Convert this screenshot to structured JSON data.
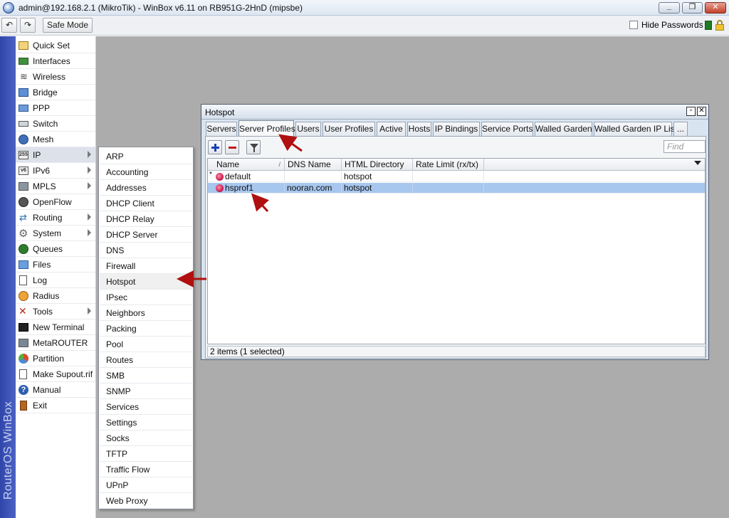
{
  "window": {
    "title": "admin@192.168.2.1 (MikroTik) - WinBox v6.11 on RB951G-2HnD (mipsbe)"
  },
  "toolbar": {
    "safe_mode_label": "Safe Mode",
    "hide_passwords_label": "Hide Passwords"
  },
  "sidebar": {
    "brand": "RouterOS WinBox",
    "items": [
      {
        "label": "Quick Set",
        "icon": "quick-set-icon"
      },
      {
        "label": "Interfaces",
        "icon": "interfaces-icon"
      },
      {
        "label": "Wireless",
        "icon": "wireless-icon"
      },
      {
        "label": "Bridge",
        "icon": "bridge-icon"
      },
      {
        "label": "PPP",
        "icon": "ppp-icon"
      },
      {
        "label": "Switch",
        "icon": "switch-icon"
      },
      {
        "label": "Mesh",
        "icon": "mesh-icon"
      },
      {
        "label": "IP",
        "icon": "ip-icon"
      },
      {
        "label": "IPv6",
        "icon": "ipv6-icon"
      },
      {
        "label": "MPLS",
        "icon": "mpls-icon"
      },
      {
        "label": "OpenFlow",
        "icon": "openflow-icon"
      },
      {
        "label": "Routing",
        "icon": "routing-icon"
      },
      {
        "label": "System",
        "icon": "system-icon"
      },
      {
        "label": "Queues",
        "icon": "queues-icon"
      },
      {
        "label": "Files",
        "icon": "files-icon"
      },
      {
        "label": "Log",
        "icon": "log-icon"
      },
      {
        "label": "Radius",
        "icon": "radius-icon"
      },
      {
        "label": "Tools",
        "icon": "tools-icon"
      },
      {
        "label": "New Terminal",
        "icon": "terminal-icon"
      },
      {
        "label": "MetaROUTER",
        "icon": "metarouter-icon"
      },
      {
        "label": "Partition",
        "icon": "partition-icon"
      },
      {
        "label": "Make Supout.rif",
        "icon": "supout-icon"
      },
      {
        "label": "Manual",
        "icon": "manual-icon"
      },
      {
        "label": "Exit",
        "icon": "exit-icon"
      }
    ]
  },
  "ip_submenu": {
    "items": [
      "ARP",
      "Accounting",
      "Addresses",
      "DHCP Client",
      "DHCP Relay",
      "DHCP Server",
      "DNS",
      "Firewall",
      "Hotspot",
      "IPsec",
      "Neighbors",
      "Packing",
      "Pool",
      "Routes",
      "SMB",
      "SNMP",
      "Services",
      "Settings",
      "Socks",
      "TFTP",
      "Traffic Flow",
      "UPnP",
      "Web Proxy"
    ]
  },
  "hotspot": {
    "title": "Hotspot",
    "tabs": [
      "Servers",
      "Server Profiles",
      "Users",
      "User Profiles",
      "Active",
      "Hosts",
      "IP Bindings",
      "Service Ports",
      "Walled Garden",
      "Walled Garden IP List",
      "..."
    ],
    "active_tab": "Server Profiles",
    "find_placeholder": "Find",
    "columns": [
      "Name",
      "DNS Name",
      "HTML Directory",
      "Rate Limit (rx/tx)"
    ],
    "rows": [
      {
        "marker": "*",
        "name": "default",
        "dns_name": "",
        "html_directory": "hotspot",
        "rate_limit": ""
      },
      {
        "marker": "",
        "name": "hsprof1",
        "dns_name": "nooran.com",
        "html_directory": "hotspot",
        "rate_limit": ""
      }
    ],
    "status": "2 items (1 selected)"
  },
  "colors": {
    "workspace": "#acacac",
    "sidebar_bar": "#3a50b5",
    "selection": "#a8c7ee",
    "annotation_arrow": "#b01010"
  }
}
